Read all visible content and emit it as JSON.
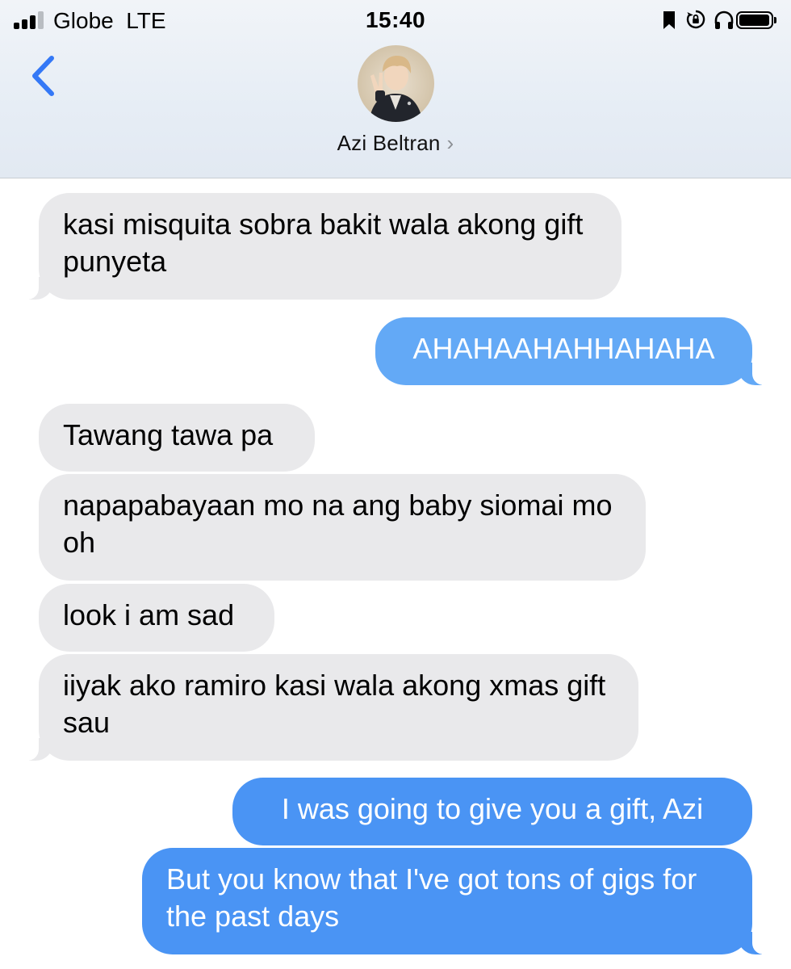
{
  "status_bar": {
    "carrier": "Globe",
    "network": "LTE",
    "time": "15:40",
    "signal_bars_active": 3,
    "icons": [
      "signal-icon",
      "bookmark-icon",
      "rotation-lock-icon",
      "headphones-icon",
      "battery-icon"
    ]
  },
  "header": {
    "back_icon": "chevron-left-icon",
    "contact_name": "Azi Beltran",
    "chevron": "›"
  },
  "messages": [
    {
      "direction": "incoming",
      "text": "kasi misquita sobra bakit wala akong gift punyeta"
    },
    {
      "direction": "outgoing",
      "text": "AHAHAAHAHHAHAHA"
    },
    {
      "direction": "incoming",
      "text": "Tawang tawa pa"
    },
    {
      "direction": "incoming",
      "text": "napapabayaan mo na ang baby siomai mo oh"
    },
    {
      "direction": "incoming",
      "text": "look i am sad"
    },
    {
      "direction": "incoming",
      "text": "iiyak ako ramiro kasi wala akong xmas gift sau"
    },
    {
      "direction": "outgoing",
      "text": "I was going to give you a gift, Azi"
    },
    {
      "direction": "outgoing",
      "text": "But you know that I've got tons of gigs for the past days"
    }
  ],
  "colors": {
    "incoming_bubble": "#e9e9eb",
    "outgoing_bubble": "#4a94f4",
    "accent": "#3478f6"
  }
}
